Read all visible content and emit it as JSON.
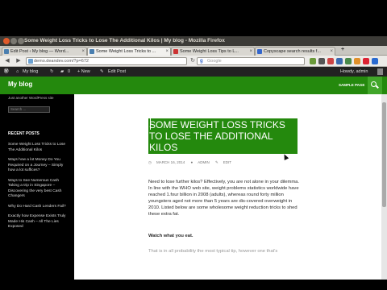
{
  "window": {
    "title": "Some Weight Loss Tricks to Lose The Additional Kilos | My blog - Mozilla Firefox"
  },
  "tabs": [
    {
      "label": "Edit Post ‹ My blog — Word...",
      "active": false
    },
    {
      "label": "Some Weight Loss Tricks to ...",
      "active": true
    },
    {
      "label": "Some Weight Loss Tips to L...",
      "active": false
    },
    {
      "label": "Copyscape search results f...",
      "active": false
    }
  ],
  "navbar": {
    "url": "demo.deandev.com/?p=672",
    "search_placeholder": "Google",
    "search_engine_letter": "g"
  },
  "adminbar": {
    "site": "My blog",
    "comments_count": "0",
    "new_label": "+ New",
    "edit_label": "Edit Post",
    "howdy": "Howdy, admin"
  },
  "site": {
    "title": "My blog",
    "tagline": "Just another WordPress site",
    "nav_sample_page": "SAMPLE PAGE",
    "search_placeholder": "Search ..."
  },
  "sidebar": {
    "recent_heading": "RECENT POSTS",
    "recent_posts": [
      "Some Weight Loss Tricks to Lose The Additional Kilos",
      "Ways how a lot Money Do You Required on a Journey – Simply how a lot suffices?",
      "Ways to See Numerous Cash Taking a trip in Singapore – Discovering the very best Cash Changers",
      "Why Do Hard Cash Lenders Fail?",
      "Exactly how Expense Exists Truly Made His Cash – All The Lies Exposed"
    ]
  },
  "article": {
    "title": "Some Weight Loss Tricks to Lose The Additional Kilos",
    "meta_date": "MARCH 16, 2014",
    "meta_author": "ADMIN",
    "meta_edit": "EDIT",
    "body": "Need to lose further kilos? Effectively, you are not alone in your dilemma. In line with the WHO web site, weight problems statistics worldwide have reached 1.four billion in 2008 (adults), whereas round forty million youngsters aged not more than 5 years are dis-covered overweight in 2010. Listed below are some wholesome weight reduction tricks to shed these extra fat.",
    "subhead": "Watch what you eat.",
    "cutoff": "That is in all probability the most typical tip, however one that's"
  }
}
